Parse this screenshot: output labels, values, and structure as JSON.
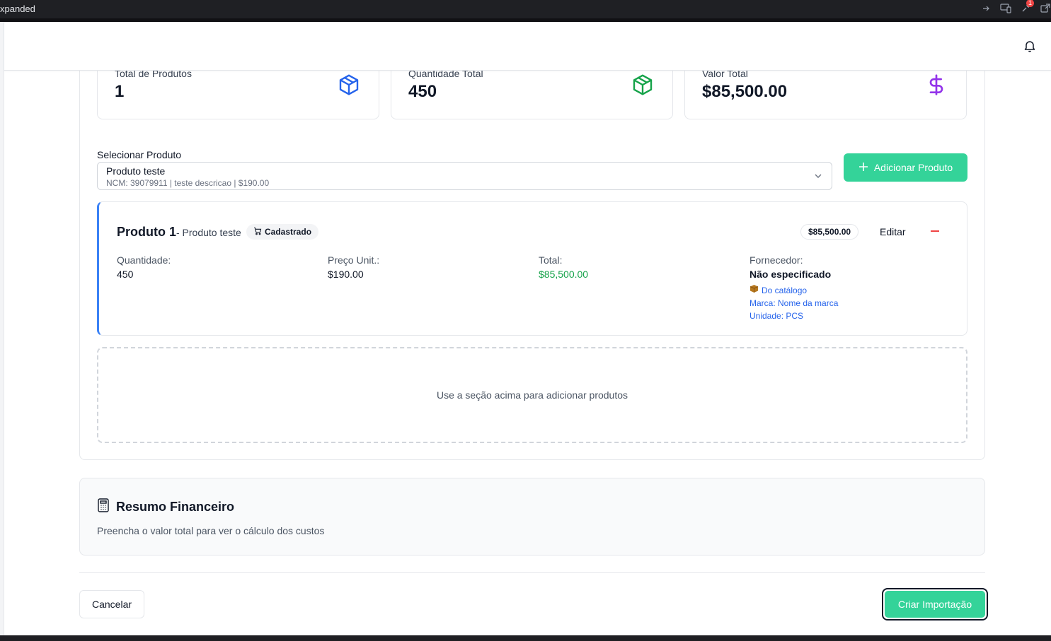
{
  "window": {
    "title": "xpanded",
    "notification_count": "1"
  },
  "stats": [
    {
      "label": "Total de Produtos",
      "value": "1",
      "icon": "package-icon",
      "color": "#2563eb"
    },
    {
      "label": "Quantidade Total",
      "value": "450",
      "icon": "package-icon",
      "color": "#16a34a"
    },
    {
      "label": "Valor Total",
      "value": "$85,500.00",
      "icon": "dollar-icon",
      "color": "#9333ea"
    }
  ],
  "product_select": {
    "label": "Selecionar Produto",
    "selected_name": "Produto teste",
    "selected_details": "NCM: 39079911 | teste descricao | $190.00"
  },
  "add_button_label": "Adicionar Produto",
  "product_item": {
    "title": "Produto 1",
    "subtitle": "- Produto teste",
    "badge": "Cadastrado",
    "price_badge": "$85,500.00",
    "edit_label": "Editar",
    "fields": {
      "quantity_label": "Quantidade:",
      "quantity_value": "450",
      "unit_price_label": "Preço Unit.:",
      "unit_price_value": "$190.00",
      "total_label": "Total:",
      "total_value": "$85,500.00",
      "supplier_label": "Fornecedor:",
      "supplier_value": "Não especificado",
      "catalog_link": "Do catálogo",
      "brand_link": "Marca: Nome da marca",
      "unit_link": "Unidade: PCS"
    }
  },
  "empty_hint": "Use a seção acima para adicionar produtos",
  "financial_summary": {
    "title": "Resumo Financeiro",
    "description": "Preencha o valor total para ver o cálculo dos custos"
  },
  "footer": {
    "cancel_label": "Cancelar",
    "create_label": "Criar Importação"
  },
  "colors": {
    "accent_green": "#34d399",
    "product_border": "#3b82f6",
    "total_green": "#16a34a",
    "link_blue": "#2563eb",
    "remove_red": "#ef4444"
  }
}
